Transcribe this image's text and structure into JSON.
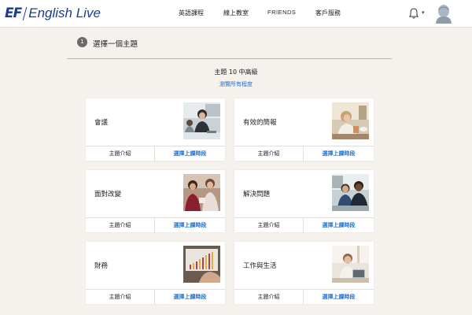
{
  "brand": {
    "logo_mark": "EF",
    "logo_text": "English Live",
    "color": "#1b3b8c"
  },
  "nav": {
    "items": [
      {
        "label": "英語課程"
      },
      {
        "label": "線上教室"
      },
      {
        "label": "FRIENDS"
      },
      {
        "label": "客戶服務"
      }
    ]
  },
  "user_menu": {
    "notification_icon": "bell-icon",
    "dropdown_icon": "chevron-down-icon",
    "avatar_icon": "user-avatar-icon"
  },
  "section": {
    "step": "1",
    "title": "選擇一個主題"
  },
  "level": {
    "label": "主題 10 中高級",
    "browse_link": "瀏覽所有程度",
    "link_color": "#1f6fd0"
  },
  "topics": [
    {
      "title": "會議",
      "intro_label": "主題介紹",
      "book_label": "選擇上課時段"
    },
    {
      "title": "有效的簡報",
      "intro_label": "主題介紹",
      "book_label": "選擇上課時段"
    },
    {
      "title": "面對改變",
      "intro_label": "主題介紹",
      "book_label": "選擇上課時段"
    },
    {
      "title": "解決問題",
      "intro_label": "主題介紹",
      "book_label": "選擇上課時段"
    },
    {
      "title": "財務",
      "intro_label": "主題介紹",
      "book_label": "選擇上課時段"
    },
    {
      "title": "工作與生活",
      "intro_label": "主題介紹",
      "book_label": "選擇上課時段"
    }
  ]
}
